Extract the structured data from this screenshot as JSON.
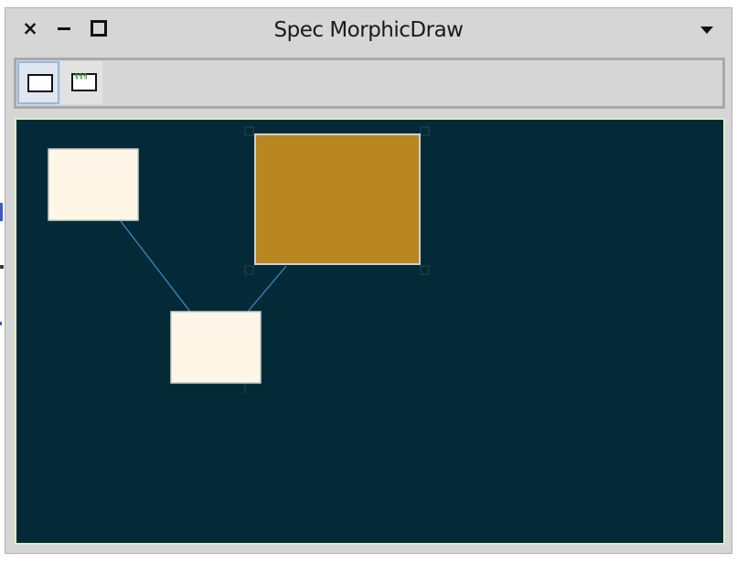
{
  "window": {
    "title": "Spec MorphicDraw",
    "controls": [
      "close",
      "minimize",
      "maximize",
      "window-menu"
    ]
  },
  "toolbar": {
    "tools": [
      {
        "name": "rectangle-tool",
        "icon": "rectangle-icon",
        "selected": true
      },
      {
        "name": "text-tool",
        "icon": "text-box-icon",
        "selected": false
      }
    ]
  },
  "canvas": {
    "background_color": "#032a36",
    "border_color": "#d9f0c8",
    "shapes": [
      {
        "id": "box-1",
        "fill": "#fff6e8",
        "border": "#c9c9c9",
        "selected": false
      },
      {
        "id": "box-2",
        "fill": "#b8871f",
        "border": "#d0d0d0",
        "selected": true
      },
      {
        "id": "box-3",
        "fill": "#fff6e8",
        "border": "#c9c9c9",
        "selected": false
      }
    ],
    "connector_color": "#3a8fd0",
    "connectors": [
      {
        "from": "box-1",
        "to": "box-3"
      },
      {
        "from": "box-2",
        "to": "box-3"
      }
    ]
  }
}
